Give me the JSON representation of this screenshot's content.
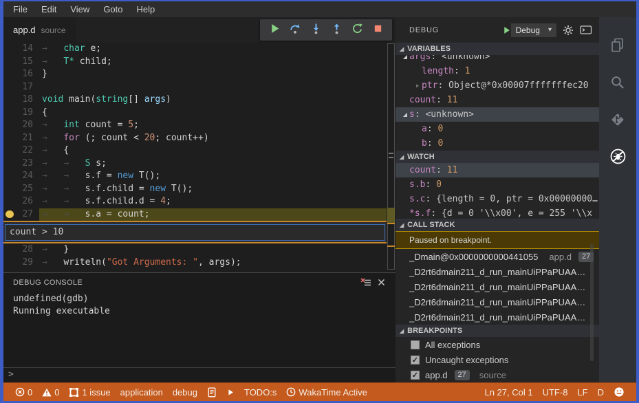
{
  "colors": {
    "window_border": "#3D5CC6",
    "statusbar_bg": "#C45A1D",
    "breakpoint_dot": "#E9C451",
    "run_green": "#89D185",
    "step_blue": "#75BEFF",
    "stop_red": "#F48771",
    "paused_banner_border": "#B08C00"
  },
  "menubar": {
    "items": [
      "File",
      "Edit",
      "View",
      "Goto",
      "Help"
    ]
  },
  "editor": {
    "tab": {
      "name": "app.d",
      "detail": "source"
    },
    "toolbar": {
      "buttons": [
        {
          "id": "continue",
          "icon": "continue"
        },
        {
          "id": "step-over",
          "icon": "step-over"
        },
        {
          "id": "step-into",
          "icon": "step-into"
        },
        {
          "id": "step-out",
          "icon": "step-out"
        },
        {
          "id": "restart",
          "icon": "restart"
        },
        {
          "id": "stop",
          "icon": "stop"
        }
      ]
    },
    "breakpoint_widget": {
      "text": "count > 10"
    },
    "lines": [
      {
        "n": 14,
        "tokens": [
          [
            "ws",
            "→   "
          ],
          [
            "type",
            "char"
          ],
          [
            "pl",
            " e;"
          ]
        ]
      },
      {
        "n": 15,
        "tokens": [
          [
            "ws",
            "→   "
          ],
          [
            "type",
            "T*"
          ],
          [
            "pl",
            " child;"
          ]
        ]
      },
      {
        "n": 16,
        "tokens": [
          [
            "pl",
            "}"
          ]
        ]
      },
      {
        "n": 17,
        "tokens": []
      },
      {
        "n": 18,
        "tokens": [
          [
            "type",
            "void"
          ],
          [
            "pl",
            " main("
          ],
          [
            "type",
            "string"
          ],
          [
            "pl",
            "[] "
          ],
          [
            "param",
            "args"
          ],
          [
            "pl",
            ")"
          ]
        ]
      },
      {
        "n": 19,
        "tokens": [
          [
            "pl",
            "{"
          ]
        ]
      },
      {
        "n": 20,
        "tokens": [
          [
            "ws",
            "→   "
          ],
          [
            "type",
            "int"
          ],
          [
            "pl",
            " count = "
          ],
          [
            "num",
            "5"
          ],
          [
            "pl",
            ";"
          ]
        ]
      },
      {
        "n": 21,
        "tokens": [
          [
            "ws",
            "→   "
          ],
          [
            "kw",
            "for"
          ],
          [
            "pl",
            " (; count < "
          ],
          [
            "num",
            "20"
          ],
          [
            "pl",
            "; count++)"
          ]
        ]
      },
      {
        "n": 22,
        "tokens": [
          [
            "ws",
            "→   "
          ],
          [
            "pl",
            "{"
          ]
        ]
      },
      {
        "n": 23,
        "tokens": [
          [
            "ws",
            "→   "
          ],
          [
            "ws",
            "→   "
          ],
          [
            "type",
            "S"
          ],
          [
            "pl",
            " s;"
          ]
        ]
      },
      {
        "n": 24,
        "tokens": [
          [
            "ws",
            "→   "
          ],
          [
            "ws",
            "→   "
          ],
          [
            "pl",
            "s.f = "
          ],
          [
            "kw2",
            "new"
          ],
          [
            "pl",
            " T();"
          ]
        ]
      },
      {
        "n": 25,
        "tokens": [
          [
            "ws",
            "→   "
          ],
          [
            "ws",
            "→   "
          ],
          [
            "pl",
            "s.f.child = "
          ],
          [
            "kw2",
            "new"
          ],
          [
            "pl",
            " T();"
          ]
        ]
      },
      {
        "n": 26,
        "tokens": [
          [
            "ws",
            "→   "
          ],
          [
            "ws",
            "→   "
          ],
          [
            "pl",
            "s.f.child.d = "
          ],
          [
            "num",
            "4"
          ],
          [
            "pl",
            ";"
          ]
        ]
      },
      {
        "n": 27,
        "breakpoint": true,
        "current": true,
        "tokens": [
          [
            "ws",
            "→   "
          ],
          [
            "ws",
            "→   "
          ],
          [
            "pl",
            "s.a = count;"
          ]
        ]
      },
      {
        "widget": true
      },
      {
        "n": 28,
        "tokens": [
          [
            "ws",
            "→   "
          ],
          [
            "pl",
            "}"
          ]
        ]
      },
      {
        "n": 29,
        "tokens": [
          [
            "ws",
            "→   "
          ],
          [
            "pl",
            "writeln("
          ],
          [
            "str",
            "\"Got Arguments: \""
          ],
          [
            "pl",
            ", args);"
          ]
        ]
      }
    ]
  },
  "console": {
    "title": "DEBUG CONSOLE",
    "output": [
      "undefined(gdb)",
      "Running executable"
    ],
    "prompt": ">"
  },
  "debug_panel": {
    "title": "DEBUG",
    "dropdown": {
      "value": "Debug"
    },
    "variables": {
      "title": "VARIABLES",
      "rows": [
        {
          "indent": 1,
          "twistie": "expanded",
          "name": "args",
          "value": "<unknown>",
          "clip": "top"
        },
        {
          "indent": 2,
          "name": "length",
          "value": "1",
          "vtype": "num"
        },
        {
          "indent": 2,
          "twistie": "collapsed",
          "name": "ptr",
          "value": "Object@*0x00007fffffffec20"
        },
        {
          "indent": 1,
          "name": "count",
          "value": "11",
          "vtype": "num"
        },
        {
          "indent": 1,
          "twistie": "expanded",
          "name": "s",
          "value": "<unknown>",
          "selected": true
        },
        {
          "indent": 2,
          "name": "a",
          "value": "0",
          "vtype": "num"
        },
        {
          "indent": 2,
          "name": "b",
          "value": "0",
          "vtype": "num"
        }
      ]
    },
    "watch": {
      "title": "WATCH",
      "rows": [
        {
          "indent": 1,
          "name": "count",
          "value": "11",
          "vtype": "num",
          "selected": true
        },
        {
          "indent": 1,
          "name": "s.b",
          "value": "0",
          "vtype": "num"
        },
        {
          "indent": 1,
          "name": "s.c",
          "value": "{length = 0, ptr = 0x00000000…"
        },
        {
          "indent": 1,
          "name": "*s.f",
          "value": "{d = 0 '\\\\x00', e = 255 '\\\\x",
          "clip": "bottom"
        }
      ]
    },
    "callstack": {
      "title": "CALL STACK",
      "banner": "Paused on breakpoint.",
      "frames": [
        {
          "name": "_Dmain@0x0000000000441055",
          "file": "app.d",
          "line": "27"
        },
        {
          "name": "_D2rt6dmain211_d_run_mainUiPPaPUAA…"
        },
        {
          "name": "_D2rt6dmain211_d_run_mainUiPPaPUAA…"
        },
        {
          "name": "_D2rt6dmain211_d_run_mainUiPPaPUAA…"
        },
        {
          "name": "_D2rt6dmain211_d_run_mainUiPPaPUAA…"
        }
      ]
    },
    "breakpoints": {
      "title": "BREAKPOINTS",
      "items": [
        {
          "label": "All exceptions",
          "checked": false
        },
        {
          "label": "Uncaught exceptions",
          "checked": true
        },
        {
          "label": "app.d",
          "badge": "27",
          "suffix": "source",
          "checked": true
        }
      ]
    }
  },
  "activity_bar": {
    "items": [
      {
        "id": "explorer",
        "icon": "files",
        "active": false
      },
      {
        "id": "search",
        "icon": "search",
        "active": false
      },
      {
        "id": "source-control",
        "icon": "git",
        "active": false
      },
      {
        "id": "debug",
        "icon": "debug",
        "active": true
      }
    ]
  },
  "statusbar": {
    "left": [
      {
        "icon": "error-circle",
        "label": "0"
      },
      {
        "icon": "warning-triangle",
        "label": "0"
      },
      {
        "icon": "issues",
        "label": "1 issue"
      },
      {
        "label": "application"
      },
      {
        "label": "debug"
      },
      {
        "icon": "output-doc",
        "label": ""
      },
      {
        "icon": "play-small",
        "label": ""
      },
      {
        "label": "TODO:s"
      },
      {
        "icon": "clock",
        "label": "WakaTime Active"
      }
    ],
    "right": [
      {
        "label": "Ln 27, Col 1"
      },
      {
        "label": "UTF-8"
      },
      {
        "label": "LF"
      },
      {
        "label": "D"
      },
      {
        "icon": "smiley",
        "label": ""
      }
    ]
  }
}
